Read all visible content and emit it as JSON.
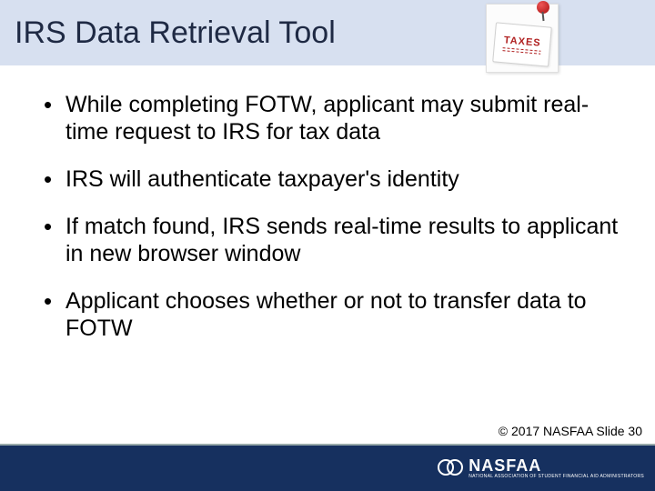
{
  "title": "IRS Data Retrieval Tool",
  "taxes_graphic": {
    "label": "TAXES"
  },
  "bullets": [
    "While completing FOTW, applicant may submit real-time request to IRS for tax data",
    "IRS will authenticate taxpayer's identity",
    "If match found, IRS sends real-time results to applicant in new browser window",
    "Applicant chooses whether or not to transfer data to FOTW"
  ],
  "footer": {
    "copyright": "© 2017 NASFAA Slide 30",
    "logo_main": "NASFAA",
    "logo_sub": "NATIONAL ASSOCIATION OF STUDENT FINANCIAL AID ADMINISTRATORS"
  }
}
